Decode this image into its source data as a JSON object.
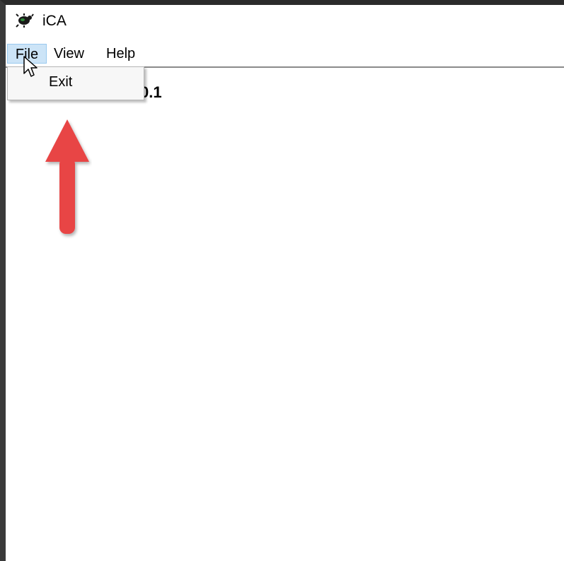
{
  "window": {
    "title": "iCA",
    "icon": "bug-icon"
  },
  "menubar": {
    "items": [
      {
        "label": "File"
      },
      {
        "label": "View"
      },
      {
        "label": "Help"
      }
    ]
  },
  "file_menu": {
    "items": [
      {
        "label": "Exit"
      }
    ]
  },
  "content": {
    "partial_text": "0.1"
  },
  "annotation": {
    "icon": "up-arrow-icon",
    "color": "#e84545"
  },
  "colors": {
    "menu_highlight": "#cce4f7",
    "menu_highlight_border": "#99c9ef"
  }
}
